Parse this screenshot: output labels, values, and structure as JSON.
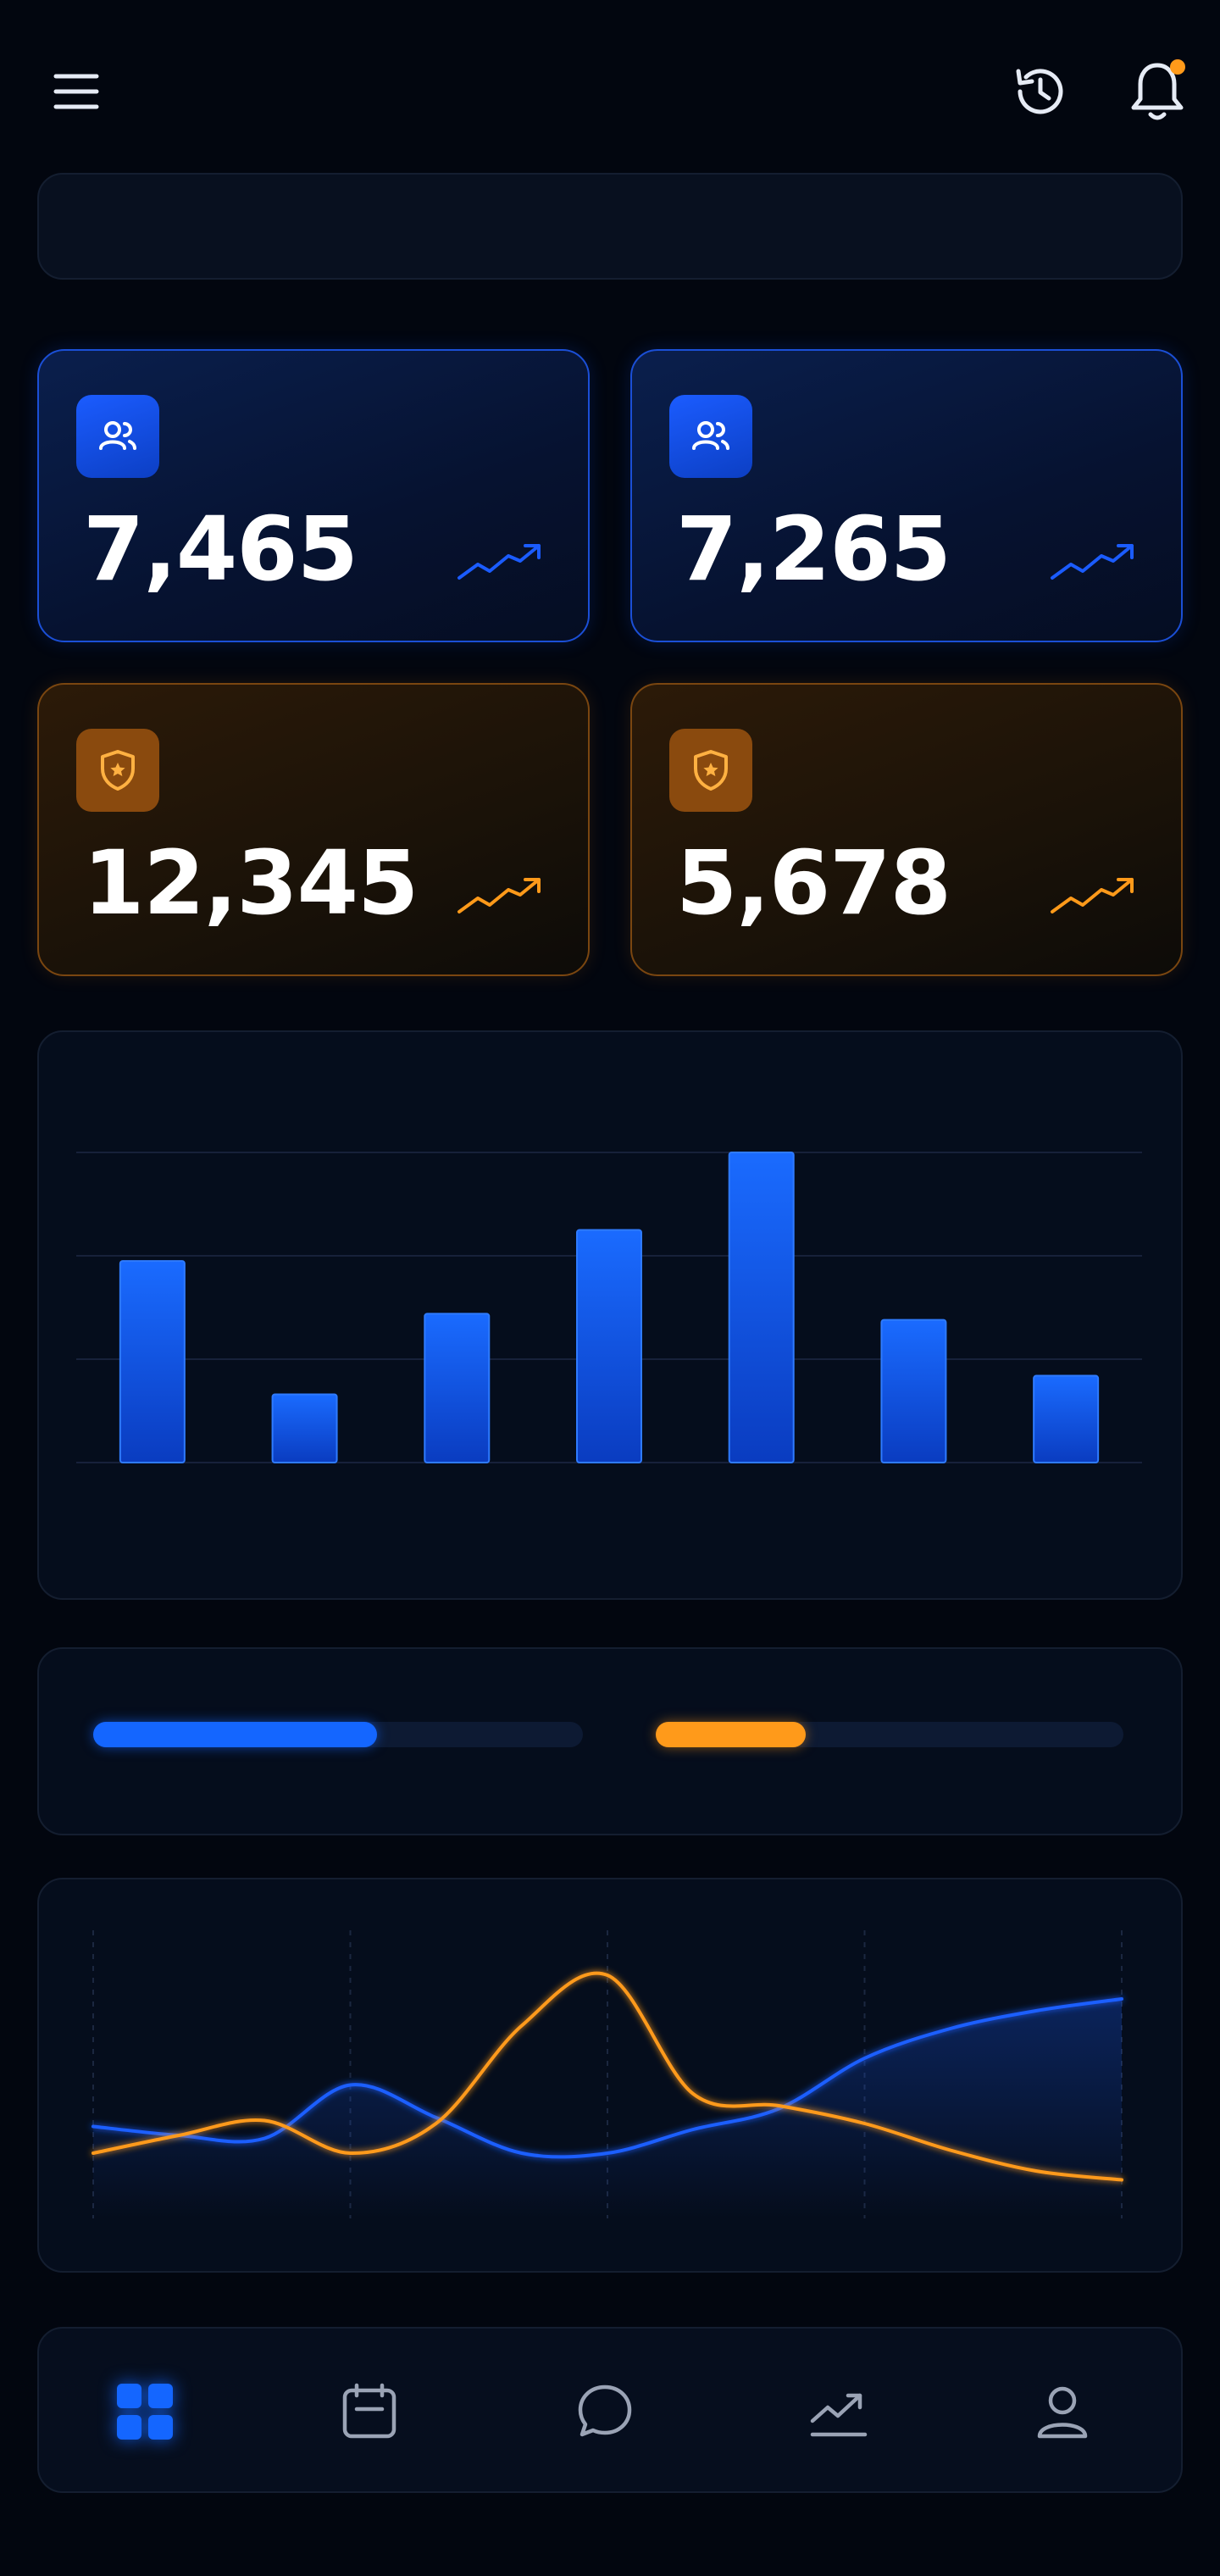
{
  "header": {
    "icons": [
      "menu-icon",
      "history-icon",
      "bell-icon"
    ],
    "notification_dot_color": "#ff9a1a"
  },
  "search": {
    "placeholder": ""
  },
  "stat_cards": [
    {
      "value": "7,465",
      "icon": "users-icon",
      "accent": "#1b5cff"
    },
    {
      "value": "7,265",
      "icon": "users-icon",
      "accent": "#1b5cff"
    },
    {
      "value": "12,345",
      "icon": "shield-star-icon",
      "accent": "#ff9a1a"
    },
    {
      "value": "5,678",
      "icon": "shield-star-icon",
      "accent": "#ff9a1a"
    }
  ],
  "bar_chart": {
    "chart_data": {
      "type": "bar",
      "values": [
        6.5,
        2.2,
        4.8,
        7.5,
        10,
        4.6,
        2.8
      ],
      "ylim": [
        0,
        10
      ],
      "grid": true,
      "color": "#1466ff"
    }
  },
  "progress": [
    {
      "fraction": 0.58,
      "color": "#1466ff"
    },
    {
      "fraction": 0.32,
      "color": "#ff9a1a"
    }
  ],
  "line_chart": {
    "chart_data": {
      "type": "line",
      "x": [
        0,
        1,
        2,
        3,
        4,
        5,
        6,
        7,
        8,
        9,
        10,
        11,
        12
      ],
      "series": [
        {
          "color": "#1a5eff",
          "values": [
            3.1,
            2.8,
            2.7,
            4.5,
            3.4,
            2.2,
            2.2,
            3.0,
            3.7,
            5.4,
            6.4,
            7.0,
            7.4
          ]
        },
        {
          "color": "#ff9a1a",
          "values": [
            2.2,
            2.8,
            3.3,
            2.2,
            3.2,
            6.5,
            8.2,
            4.2,
            3.8,
            3.2,
            2.3,
            1.6,
            1.3
          ]
        }
      ],
      "ylim": [
        0,
        10
      ],
      "grid": true
    }
  },
  "bottom_nav": {
    "items": [
      {
        "icon": "dashboard-icon",
        "active": true
      },
      {
        "icon": "calendar-icon",
        "active": false
      },
      {
        "icon": "chat-icon",
        "active": false
      },
      {
        "icon": "analytics-icon",
        "active": false
      },
      {
        "icon": "profile-icon",
        "active": false
      }
    ],
    "active_color": "#1466ff",
    "inactive_color": "#9aa3b5"
  }
}
